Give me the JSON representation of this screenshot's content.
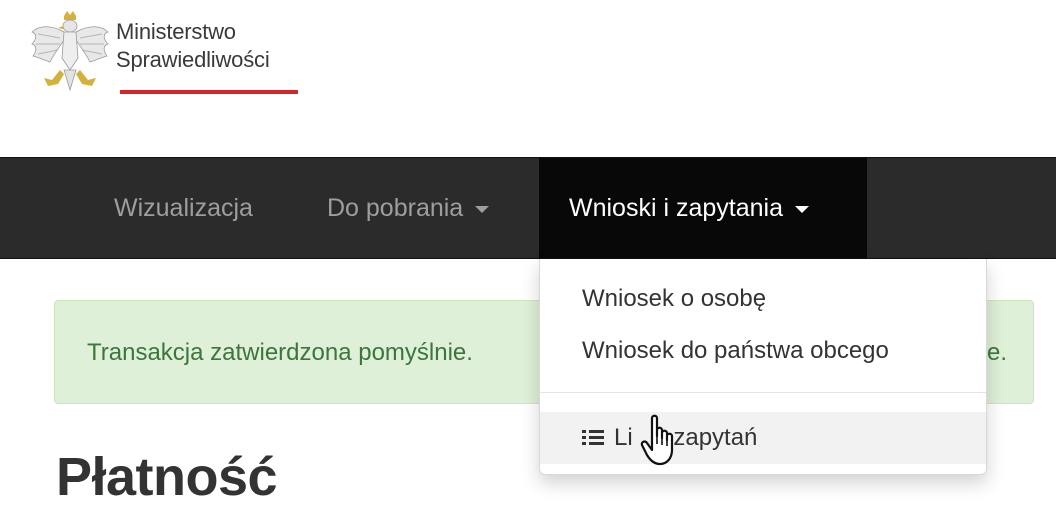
{
  "header": {
    "logo_line1": "Ministerstwo",
    "logo_line2": "Sprawiedliwości",
    "logo_icon": "polish-eagle-emblem",
    "accent_color": "#d6262c"
  },
  "navbar": {
    "items": [
      {
        "label": "Wizualizacja"
      },
      {
        "label": "Do pobrania"
      },
      {
        "label": "Wnioski i zapytania"
      }
    ]
  },
  "dropdown": {
    "items": [
      {
        "label": "Wniosek o osobę"
      },
      {
        "label": "Wniosek do państwa obcego"
      },
      {
        "label": "Lista zapytań",
        "icon": "list-icon",
        "visible_text": "Li zapytań"
      }
    ]
  },
  "alert": {
    "text": "Transakcja zatwierdzona pomyślnie.",
    "tail": "e.",
    "color": "#3c763d",
    "background": "#dff0d8"
  },
  "page": {
    "title": "Płatność"
  }
}
